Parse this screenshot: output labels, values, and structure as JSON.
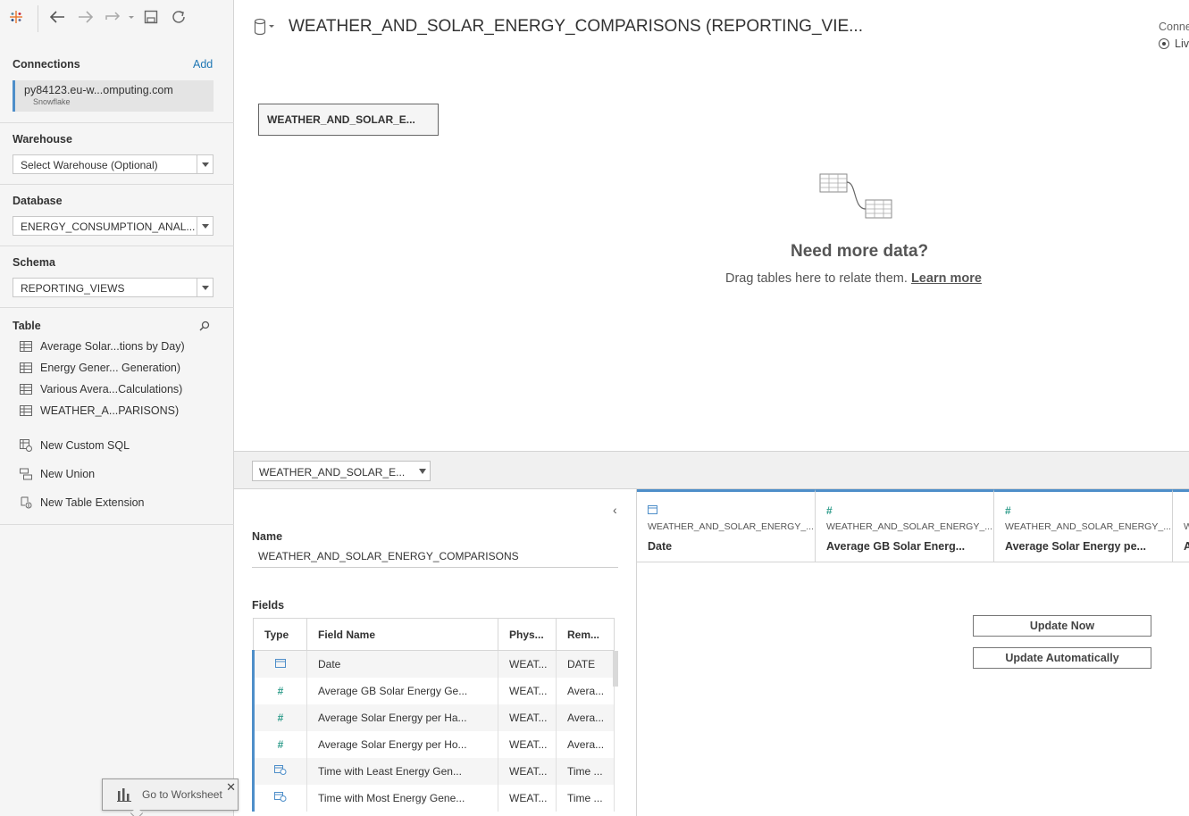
{
  "datasource": {
    "title": "WEATHER_AND_SOLAR_ENERGY_COMPARISONS (REPORTING_VIE...",
    "connection_label": "Conne",
    "live_label": "Liv"
  },
  "sidebar": {
    "connections_title": "Connections",
    "add_label": "Add",
    "connection": {
      "host": "py84123.eu-w...omputing.com",
      "type": "Snowflake"
    },
    "warehouse_title": "Warehouse",
    "warehouse_value": "Select Warehouse (Optional)",
    "database_title": "Database",
    "database_value": "ENERGY_CONSUMPTION_ANAL...",
    "schema_title": "Schema",
    "schema_value": "REPORTING_VIEWS",
    "table_title": "Table",
    "tables": [
      {
        "label": "Average Solar...tions by Day)"
      },
      {
        "label": "Energy Gener... Generation)"
      },
      {
        "label": "Various Avera...Calculations)"
      },
      {
        "label": "WEATHER_A...PARISONS)"
      }
    ],
    "actions": [
      {
        "label": "New Custom SQL"
      },
      {
        "label": "New Union"
      },
      {
        "label": "New Table Extension"
      }
    ],
    "goto_worksheet": "Go to Worksheet"
  },
  "canvas": {
    "table_box": "WEATHER_AND_SOLAR_E...",
    "need_more": "Need more data?",
    "drag_text": "Drag tables here to relate them.",
    "learn_more": "Learn more"
  },
  "bottom": {
    "table_select": "WEATHER_AND_SOLAR_E...",
    "name_label": "Name",
    "name_value": "WEATHER_AND_SOLAR_ENERGY_COMPARISONS",
    "fields_label": "Fields",
    "fields_headers": [
      "Type",
      "Field Name",
      "Phys...",
      "Rem..."
    ],
    "fields": [
      {
        "type": "date",
        "icon": "🗓",
        "name": "Date",
        "phys": "WEAT...",
        "remote": "DATE"
      },
      {
        "type": "number",
        "icon": "#",
        "name": "Average GB Solar Energy Ge...",
        "phys": "WEAT...",
        "remote": "Avera..."
      },
      {
        "type": "number",
        "icon": "#",
        "name": "Average Solar Energy per Ha...",
        "phys": "WEAT...",
        "remote": "Avera..."
      },
      {
        "type": "number",
        "icon": "#",
        "name": "Average Solar Energy per Ho...",
        "phys": "WEAT...",
        "remote": "Avera..."
      },
      {
        "type": "datetime",
        "icon": "🗓",
        "name": "Time with Least Energy Gen...",
        "phys": "WEAT...",
        "remote": "Time ..."
      },
      {
        "type": "datetime",
        "icon": "🗓",
        "name": "Time with Most Energy Gene...",
        "phys": "WEAT...",
        "remote": "Time ..."
      }
    ],
    "grid_columns": [
      {
        "icon": "date",
        "source": "WEATHER_AND_SOLAR_ENERGY_...",
        "name": "Date"
      },
      {
        "icon": "#",
        "source": "WEATHER_AND_SOLAR_ENERGY_...",
        "name": "Average GB Solar Energ..."
      },
      {
        "icon": "#",
        "source": "WEATHER_AND_SOLAR_ENERGY_...",
        "name": "Average Solar Energy pe..."
      },
      {
        "icon": "",
        "source": "W",
        "name": "A"
      }
    ],
    "update_now": "Update Now",
    "update_auto": "Update Automatically"
  },
  "colors": {
    "accent_blue": "#4e8ec9",
    "link_blue": "#1f77b4",
    "numeric_teal": "#2f9c8b"
  }
}
